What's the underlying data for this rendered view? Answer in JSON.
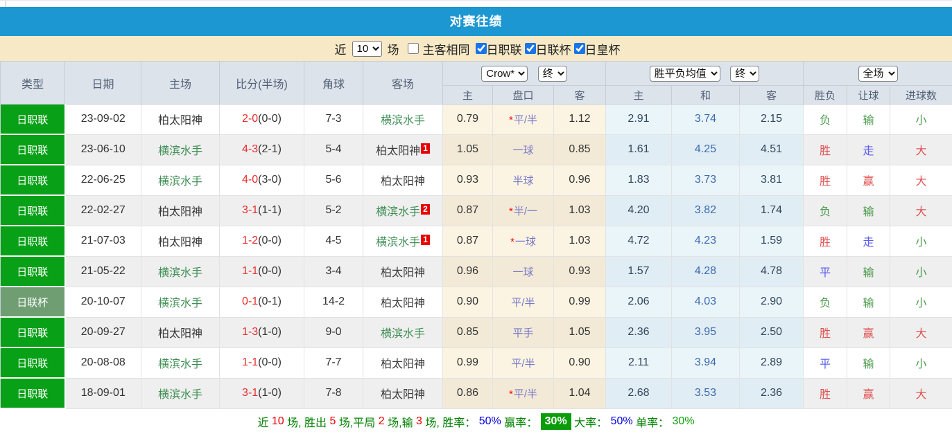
{
  "title": "对赛往绩",
  "filter": {
    "near_label": "近",
    "count_value": "10",
    "matches_label": "场",
    "same_side_label": "主客相同",
    "same_side_checked": false,
    "leagues": [
      {
        "label": "日职联",
        "checked": true
      },
      {
        "label": "日联杯",
        "checked": true
      },
      {
        "label": "日皇杯",
        "checked": true
      }
    ]
  },
  "colors": {
    "title_bar": "#1d97d2",
    "filter_bar": "#f7e9c6",
    "league_badge": "#07a016",
    "cup_badge": "#6f9e73",
    "win_red": "#e05252",
    "lose_green": "#4c9b4c",
    "draw_blue": "#5d5df0",
    "highlight_box": "#0b9c0b"
  },
  "table": {
    "headers": {
      "type": "类型",
      "date": "日期",
      "home": "主场",
      "score": "比分(半场)",
      "corner": "角球",
      "away": "客场",
      "sub": [
        "主",
        "盘口",
        "客",
        "主",
        "和",
        "客",
        "胜负",
        "让球",
        "进球数"
      ]
    },
    "selects": {
      "odds_source": "Crow*",
      "odds_time1": "终",
      "avg_type": "胜平负均值",
      "odds_time2": "终",
      "scope": "全场"
    },
    "rows": [
      {
        "type": {
          "label": "日职联",
          "variant": "league"
        },
        "date": "23-09-02",
        "home": {
          "name": "柏太阳神",
          "team": "kashiwa"
        },
        "score": {
          "full": "2-0",
          "half": "(0-0)"
        },
        "corner": "7-3",
        "away": {
          "name": "横滨水手",
          "team": "yokohama"
        },
        "crow": {
          "home": "0.79",
          "star": true,
          "line": "平/半",
          "away": "1.12"
        },
        "avg": {
          "home": "2.91",
          "draw": "3.74",
          "away": "2.15"
        },
        "result": {
          "text": "负",
          "color": "green"
        },
        "handicap": {
          "text": "输",
          "color": "green"
        },
        "goals": {
          "text": "小",
          "color": "green"
        }
      },
      {
        "type": {
          "label": "日职联",
          "variant": "league"
        },
        "date": "23-06-10",
        "home": {
          "name": "横滨水手",
          "team": "yokohama"
        },
        "score": {
          "full": "4-3",
          "half": "(2-1)"
        },
        "corner": "5-4",
        "away": {
          "name": "柏太阳神",
          "team": "kashiwa",
          "card": "1"
        },
        "crow": {
          "home": "1.05",
          "star": false,
          "line": "一球",
          "away": "0.85"
        },
        "avg": {
          "home": "1.61",
          "draw": "4.25",
          "away": "4.51"
        },
        "result": {
          "text": "胜",
          "color": "red"
        },
        "handicap": {
          "text": "走",
          "color": "blue"
        },
        "goals": {
          "text": "大",
          "color": "red"
        }
      },
      {
        "type": {
          "label": "日职联",
          "variant": "league"
        },
        "date": "22-06-25",
        "home": {
          "name": "横滨水手",
          "team": "yokohama"
        },
        "score": {
          "full": "4-0",
          "half": "(3-0)"
        },
        "corner": "5-6",
        "away": {
          "name": "柏太阳神",
          "team": "kashiwa"
        },
        "crow": {
          "home": "0.93",
          "star": false,
          "line": "半球",
          "away": "0.96"
        },
        "avg": {
          "home": "1.83",
          "draw": "3.73",
          "away": "3.81"
        },
        "result": {
          "text": "胜",
          "color": "red"
        },
        "handicap": {
          "text": "赢",
          "color": "red"
        },
        "goals": {
          "text": "大",
          "color": "red"
        }
      },
      {
        "type": {
          "label": "日职联",
          "variant": "league"
        },
        "date": "22-02-27",
        "home": {
          "name": "柏太阳神",
          "team": "kashiwa"
        },
        "score": {
          "full": "3-1",
          "half": "(1-1)"
        },
        "corner": "5-2",
        "away": {
          "name": "横滨水手",
          "team": "yokohama",
          "card": "2"
        },
        "crow": {
          "home": "0.87",
          "star": true,
          "line": "半/一",
          "away": "1.03"
        },
        "avg": {
          "home": "4.20",
          "draw": "3.82",
          "away": "1.74"
        },
        "result": {
          "text": "负",
          "color": "green"
        },
        "handicap": {
          "text": "输",
          "color": "green"
        },
        "goals": {
          "text": "大",
          "color": "red"
        }
      },
      {
        "type": {
          "label": "日职联",
          "variant": "league"
        },
        "date": "21-07-03",
        "home": {
          "name": "柏太阳神",
          "team": "kashiwa"
        },
        "score": {
          "full": "1-2",
          "half": "(0-0)"
        },
        "corner": "4-5",
        "away": {
          "name": "横滨水手",
          "team": "yokohama",
          "card": "1"
        },
        "crow": {
          "home": "0.87",
          "star": true,
          "line": "一球",
          "away": "1.03"
        },
        "avg": {
          "home": "4.72",
          "draw": "4.23",
          "away": "1.59"
        },
        "result": {
          "text": "胜",
          "color": "red"
        },
        "handicap": {
          "text": "走",
          "color": "blue"
        },
        "goals": {
          "text": "小",
          "color": "green"
        }
      },
      {
        "type": {
          "label": "日职联",
          "variant": "league"
        },
        "date": "21-05-22",
        "home": {
          "name": "横滨水手",
          "team": "yokohama"
        },
        "score": {
          "full": "1-1",
          "half": "(0-0)"
        },
        "corner": "3-4",
        "away": {
          "name": "柏太阳神",
          "team": "kashiwa"
        },
        "crow": {
          "home": "0.96",
          "star": false,
          "line": "一球",
          "away": "0.93"
        },
        "avg": {
          "home": "1.57",
          "draw": "4.28",
          "away": "4.78"
        },
        "result": {
          "text": "平",
          "color": "blue"
        },
        "handicap": {
          "text": "输",
          "color": "green"
        },
        "goals": {
          "text": "小",
          "color": "green"
        }
      },
      {
        "type": {
          "label": "日联杯",
          "variant": "cup"
        },
        "date": "20-10-07",
        "home": {
          "name": "横滨水手",
          "team": "yokohama"
        },
        "score": {
          "full": "0-1",
          "half": "(0-1)"
        },
        "corner": "14-2",
        "away": {
          "name": "柏太阳神",
          "team": "kashiwa"
        },
        "crow": {
          "home": "0.90",
          "star": false,
          "line": "平/半",
          "away": "0.99"
        },
        "avg": {
          "home": "2.06",
          "draw": "4.03",
          "away": "2.90"
        },
        "result": {
          "text": "负",
          "color": "green"
        },
        "handicap": {
          "text": "输",
          "color": "green"
        },
        "goals": {
          "text": "小",
          "color": "green"
        }
      },
      {
        "type": {
          "label": "日职联",
          "variant": "league"
        },
        "date": "20-09-27",
        "home": {
          "name": "柏太阳神",
          "team": "kashiwa"
        },
        "score": {
          "full": "1-3",
          "half": "(1-0)"
        },
        "corner": "9-0",
        "away": {
          "name": "横滨水手",
          "team": "yokohama"
        },
        "crow": {
          "home": "0.85",
          "star": false,
          "line": "平手",
          "away": "1.05"
        },
        "avg": {
          "home": "2.36",
          "draw": "3.95",
          "away": "2.50"
        },
        "result": {
          "text": "胜",
          "color": "red"
        },
        "handicap": {
          "text": "赢",
          "color": "red"
        },
        "goals": {
          "text": "大",
          "color": "red"
        }
      },
      {
        "type": {
          "label": "日职联",
          "variant": "league"
        },
        "date": "20-08-08",
        "home": {
          "name": "横滨水手",
          "team": "yokohama"
        },
        "score": {
          "full": "1-1",
          "half": "(0-0)"
        },
        "corner": "7-7",
        "away": {
          "name": "柏太阳神",
          "team": "kashiwa"
        },
        "crow": {
          "home": "0.99",
          "star": false,
          "line": "平/半",
          "away": "0.90"
        },
        "avg": {
          "home": "2.11",
          "draw": "3.94",
          "away": "2.89"
        },
        "result": {
          "text": "平",
          "color": "blue"
        },
        "handicap": {
          "text": "输",
          "color": "green"
        },
        "goals": {
          "text": "小",
          "color": "green"
        }
      },
      {
        "type": {
          "label": "日职联",
          "variant": "league"
        },
        "date": "18-09-01",
        "home": {
          "name": "横滨水手",
          "team": "yokohama"
        },
        "score": {
          "full": "3-1",
          "half": "(1-0)"
        },
        "corner": "7-8",
        "away": {
          "name": "柏太阳神",
          "team": "kashiwa"
        },
        "crow": {
          "home": "0.86",
          "star": true,
          "line": "平/半",
          "away": "1.04"
        },
        "avg": {
          "home": "2.68",
          "draw": "3.53",
          "away": "2.36"
        },
        "result": {
          "text": "胜",
          "color": "red"
        },
        "handicap": {
          "text": "赢",
          "color": "red"
        },
        "goals": {
          "text": "大",
          "color": "red"
        }
      }
    ]
  },
  "footer": {
    "segments": [
      {
        "t": "近 ",
        "c": "g"
      },
      {
        "t": "10",
        "c": "r"
      },
      {
        "t": " 场, ",
        "c": "g"
      },
      {
        "t": "胜出 ",
        "c": "g"
      },
      {
        "t": "5",
        "c": "r"
      },
      {
        "t": " 场,",
        "c": "g"
      },
      {
        "t": "平局 ",
        "c": "g"
      },
      {
        "t": "2",
        "c": "r"
      },
      {
        "t": " 场,",
        "c": "g"
      },
      {
        "t": "输 ",
        "c": "g"
      },
      {
        "t": "3",
        "c": "r"
      },
      {
        "t": " 场, ",
        "c": "g"
      },
      {
        "t": "胜率： ",
        "c": "g"
      },
      {
        "t": "50%",
        "c": "b"
      },
      {
        "t": " 赢率： ",
        "c": "g"
      },
      {
        "t": "30%",
        "c": "hl"
      },
      {
        "t": " 大率： ",
        "c": "g"
      },
      {
        "t": "50%",
        "c": "b"
      },
      {
        "t": " 单率： ",
        "c": "g"
      },
      {
        "t": "30%",
        "c": "g2"
      }
    ]
  }
}
